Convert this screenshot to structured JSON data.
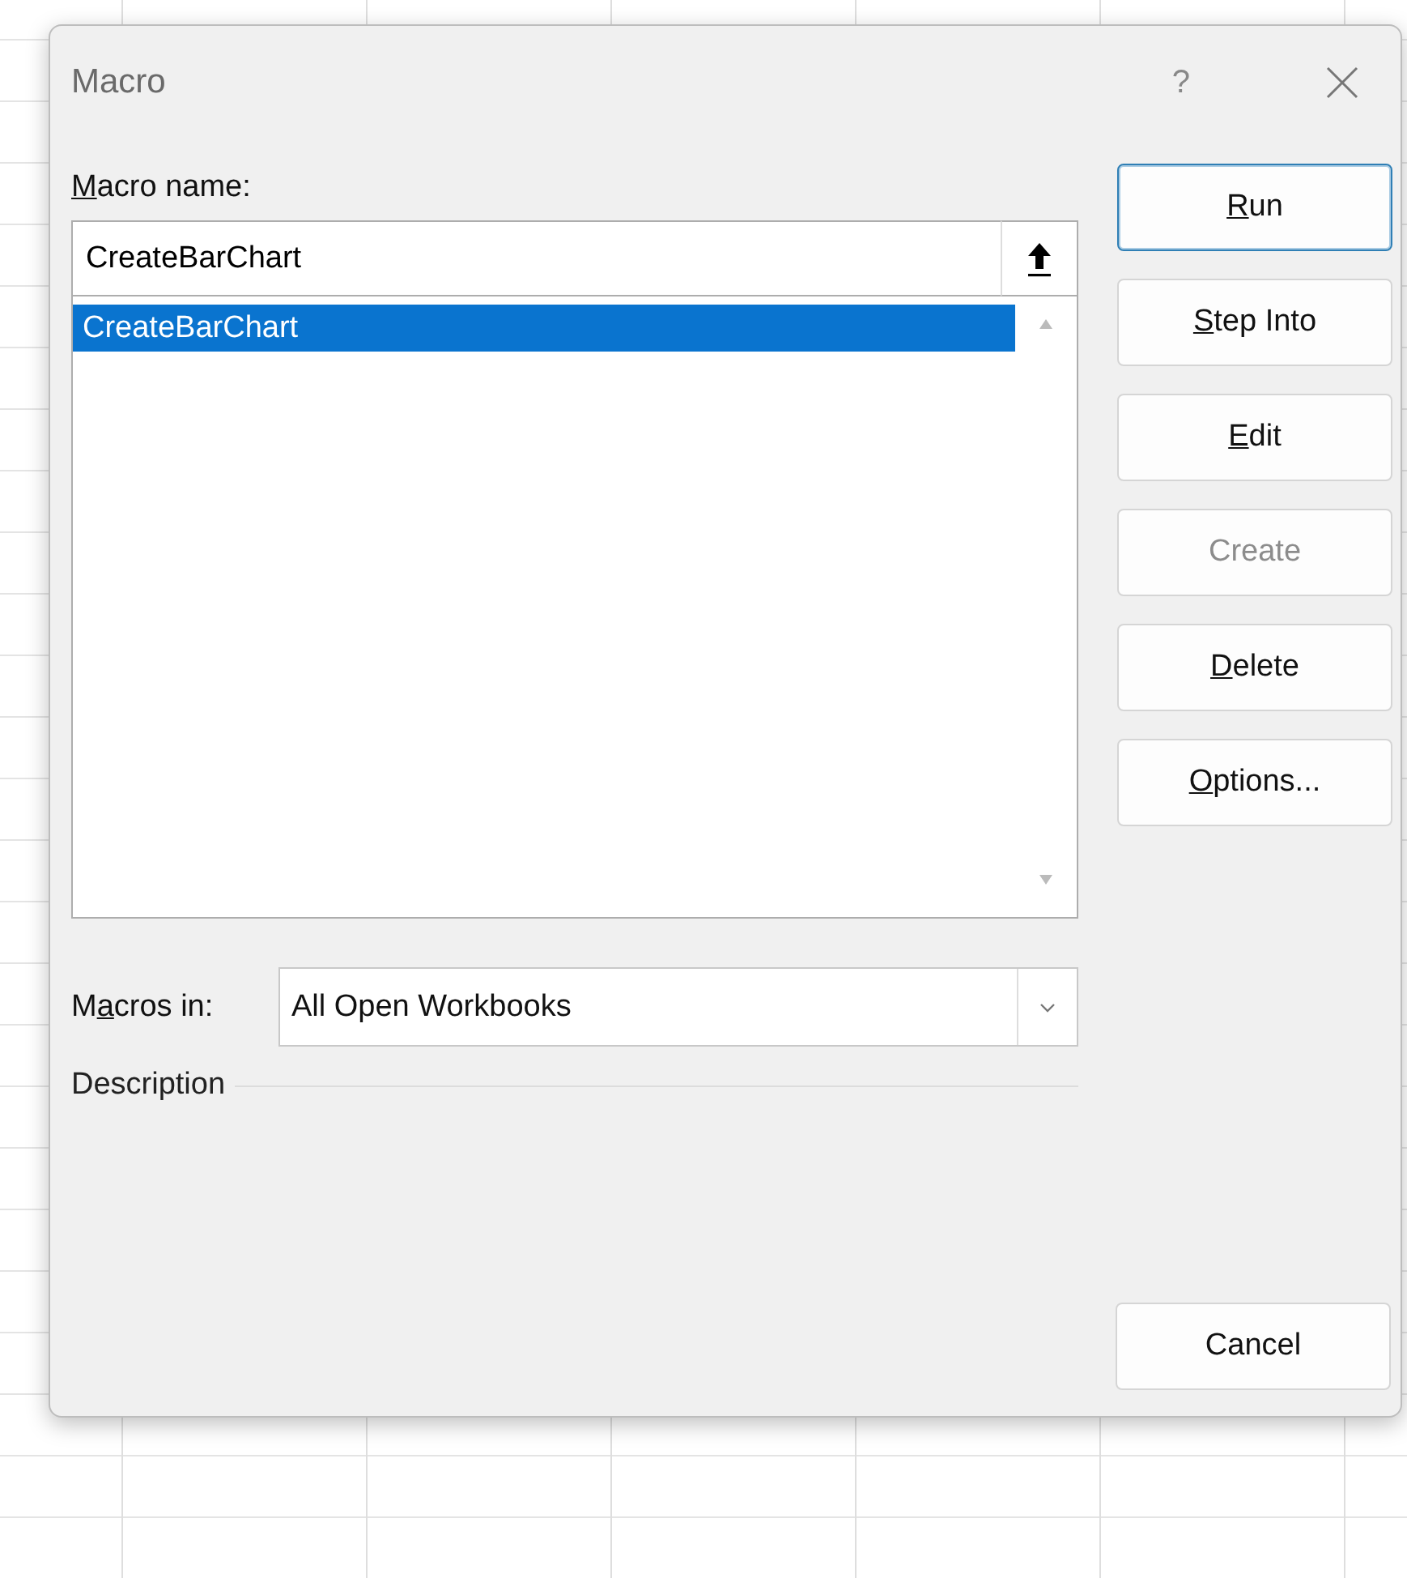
{
  "window": {
    "title": "Macro",
    "help_glyph": "?"
  },
  "macro_name": {
    "label": {
      "key": "M",
      "post": "acro name:"
    },
    "value": "CreateBarChart"
  },
  "macro_list": [
    {
      "name": "CreateBarChart",
      "selected": true
    }
  ],
  "buttons": [
    {
      "key": "R",
      "post": "un",
      "default": true,
      "disabled": false
    },
    {
      "key": "S",
      "post": "tep Into",
      "default": false,
      "disabled": false
    },
    {
      "key": "E",
      "post": "dit",
      "default": false,
      "disabled": false
    },
    {
      "pre": "Create",
      "default": false,
      "disabled": true
    },
    {
      "key": "D",
      "post": "elete",
      "default": false,
      "disabled": false
    },
    {
      "key": "O",
      "post": "ptions...",
      "default": false,
      "disabled": false
    }
  ],
  "macros_in": {
    "label": {
      "pre": "M",
      "key": "a",
      "post": "cros in:"
    },
    "value": "All Open Workbooks"
  },
  "description": {
    "label": "Description"
  },
  "cancel_button": {
    "label": "Cancel"
  }
}
